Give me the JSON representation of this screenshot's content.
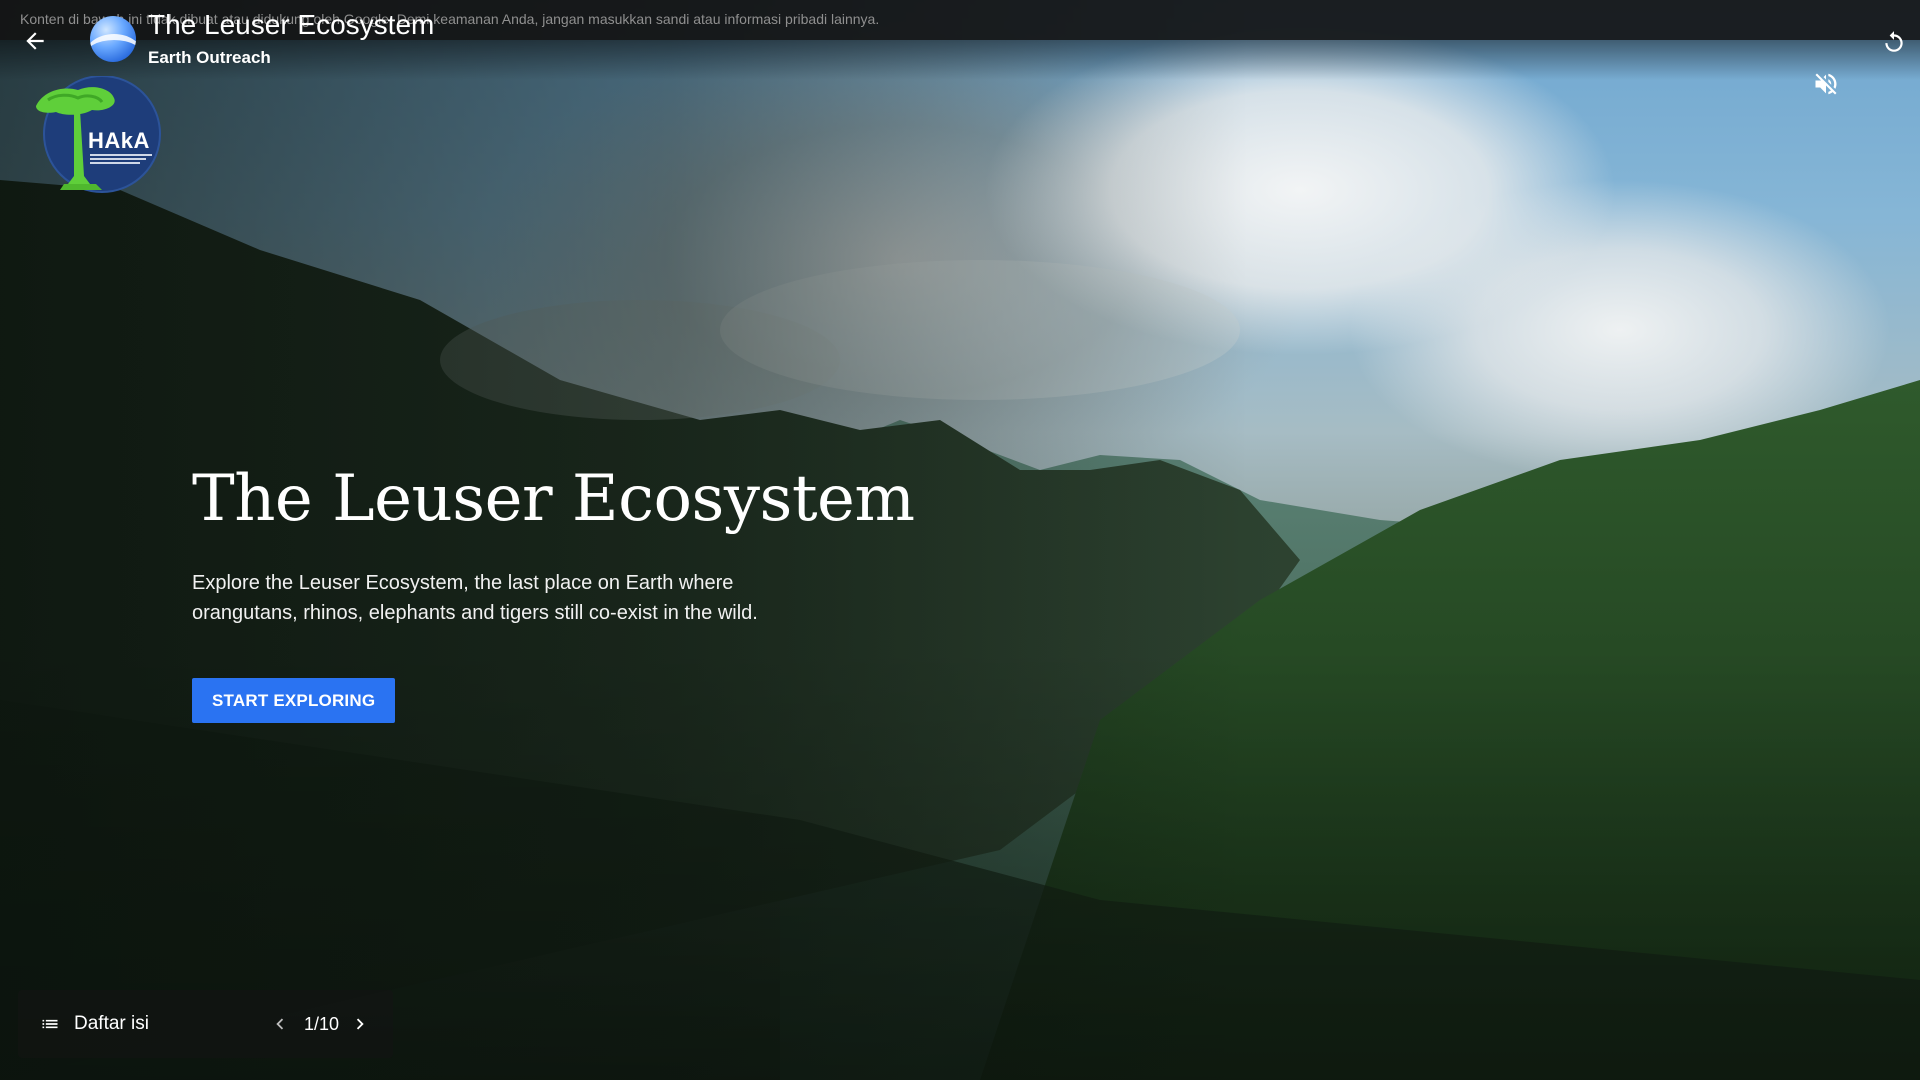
{
  "notice_text": "Konten di bawah ini tidak dibuat atau didukung oleh Google. Demi keamanan Anda, jangan masukkan sandi atau informasi pribadi lainnya.",
  "header": {
    "title": "The Leuser Ecosystem",
    "subtitle": "Earth Outreach"
  },
  "hero": {
    "title": "The Leuser Ecosystem",
    "description": "Explore the Leuser Ecosystem, the last place on Earth where orangutans, rhinos, elephants and tigers still co-exist in the wild.",
    "cta_label": "START EXPLORING"
  },
  "partner_logo": {
    "text": "HAkA"
  },
  "bottom_nav": {
    "toc_label": "Daftar isi",
    "page_indicator": "1/10"
  },
  "icons": {
    "back": "arrow-left-icon",
    "replay": "replay-icon",
    "mute": "volume-off-icon",
    "toc": "list-icon",
    "prev": "chevron-left-icon",
    "next": "chevron-right-icon"
  },
  "colors": {
    "accent": "#2a73f2",
    "topbar": "#121212"
  }
}
